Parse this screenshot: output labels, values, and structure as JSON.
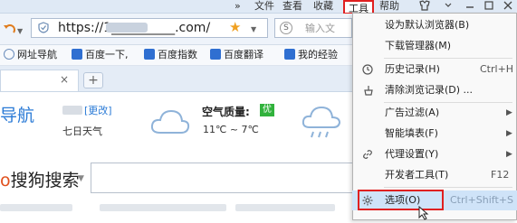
{
  "menubar": {
    "more": "»",
    "file": "文件",
    "view": "查看",
    "favorites": "收藏",
    "tools": "工具",
    "help": "帮助"
  },
  "address": {
    "url": "https://1__________.com/",
    "search_placeholder": "输入文"
  },
  "bookmarks": [
    {
      "label": "网址导航",
      "icon": "globe-icon"
    },
    {
      "label": "百度一下,",
      "icon": "paw-icon"
    },
    {
      "label": "百度指数",
      "icon": "paw-icon"
    },
    {
      "label": "百度翻译",
      "icon": "translate-icon"
    },
    {
      "label": "我的经验",
      "icon": "paw-icon"
    }
  ],
  "tab": {
    "close": "×",
    "new_tab": "+"
  },
  "page": {
    "nav_title": "导航",
    "city_change": "[更改]",
    "weather_label": "七日天气",
    "air_quality_label": "空气质量:",
    "air_quality_value": "优",
    "temperature": "11℃ ~ 7℃",
    "search_logo_o": "o",
    "search_logo": "搜狗搜索"
  },
  "tools_menu": {
    "items": [
      {
        "label": "设为默认浏览器(B)",
        "shortcut": "",
        "arrow": false,
        "icon": ""
      },
      {
        "label": "下载管理器(M)",
        "shortcut": "",
        "arrow": false,
        "icon": ""
      },
      {
        "label": "历史记录(H)",
        "shortcut": "Ctrl+H",
        "arrow": false,
        "icon": "clock-icon"
      },
      {
        "label": "清除浏览记录(D) ...",
        "shortcut": "",
        "arrow": false,
        "icon": "broom-icon"
      },
      {
        "label": "广告过滤(A)",
        "shortcut": "",
        "arrow": true,
        "icon": ""
      },
      {
        "label": "智能填表(F)",
        "shortcut": "",
        "arrow": true,
        "icon": ""
      },
      {
        "label": "代理设置(Y)",
        "shortcut": "",
        "arrow": true,
        "icon": "link-icon"
      },
      {
        "label": "开发者工具(T)",
        "shortcut": "F12",
        "arrow": false,
        "icon": ""
      },
      {
        "label": "选项(O)",
        "shortcut": "Ctrl+Shift+S",
        "arrow": false,
        "icon": "gear-icon"
      }
    ]
  },
  "colors": {
    "highlight_border": "#e02020",
    "accent_blue": "#2a7ad6",
    "air_good": "#31b23c",
    "menu_selected": "#cfe3f8"
  }
}
